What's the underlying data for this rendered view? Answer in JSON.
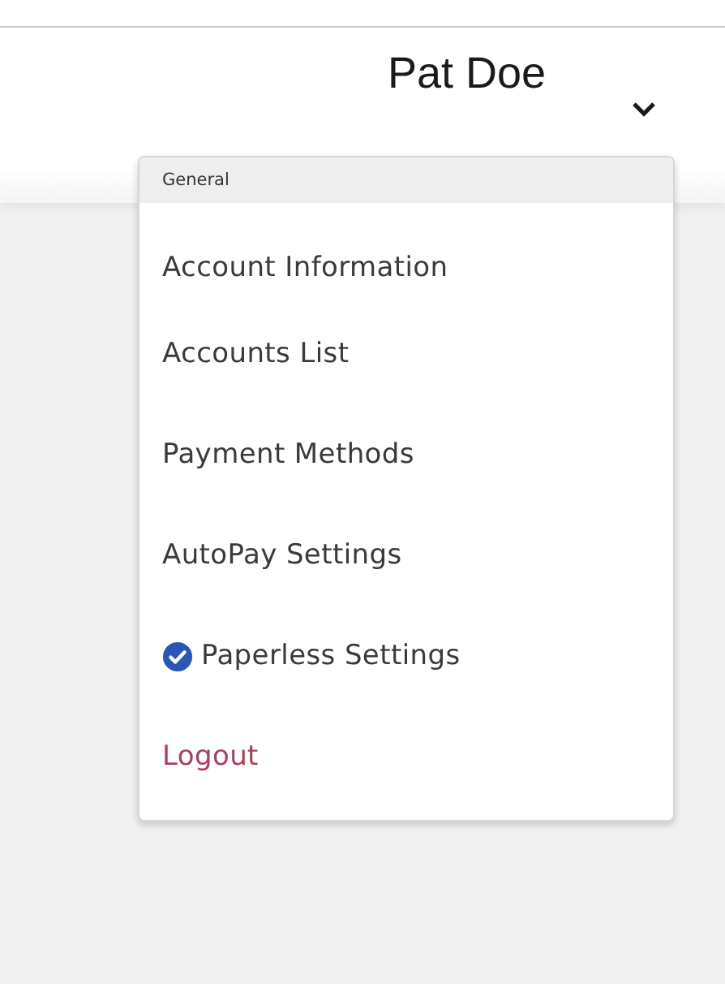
{
  "header": {
    "user_name": "Pat Doe"
  },
  "menu": {
    "section_title": "General",
    "items": [
      {
        "label": "Account Information",
        "kind": "link",
        "checked": false
      },
      {
        "label": "Accounts List",
        "kind": "link",
        "checked": false
      },
      {
        "label": "Payment Methods",
        "kind": "link",
        "checked": false
      },
      {
        "label": "AutoPay Settings",
        "kind": "link",
        "checked": false
      },
      {
        "label": "Paperless Settings",
        "kind": "link",
        "checked": true
      },
      {
        "label": "Logout",
        "kind": "logout",
        "checked": false
      }
    ]
  }
}
